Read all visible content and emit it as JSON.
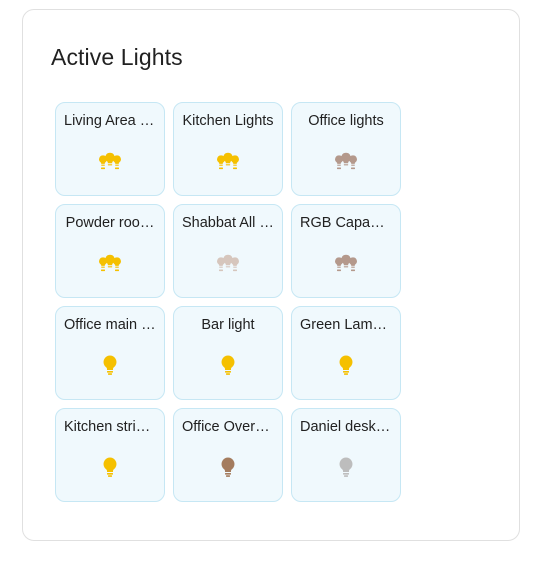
{
  "card": {
    "title": "Active Lights"
  },
  "lights": [
    {
      "name": "Living Area L…",
      "icon": "bulb-group-icon",
      "color": "#f5c000"
    },
    {
      "name": "Kitchen Lights",
      "icon": "bulb-group-icon",
      "color": "#f5c000"
    },
    {
      "name": "Office lights",
      "icon": "bulb-group-icon",
      "color": "#b4998c"
    },
    {
      "name": "Powder roo…",
      "icon": "bulb-group-icon",
      "color": "#f5c000"
    },
    {
      "name": "Shabbat All l…",
      "icon": "bulb-group-icon",
      "color": "#d6c6bd"
    },
    {
      "name": "RGB Capable…",
      "icon": "bulb-group-icon",
      "color": "#b4998c"
    },
    {
      "name": "Office main (…",
      "icon": "bulb-icon",
      "color": "#f5c000"
    },
    {
      "name": "Bar light",
      "icon": "bulb-icon",
      "color": "#f5c000"
    },
    {
      "name": "Green Lamp …",
      "icon": "bulb-icon",
      "color": "#f5c000"
    },
    {
      "name": "Kitchen strip …",
      "icon": "bulb-icon",
      "color": "#f5c000"
    },
    {
      "name": "Office Overh…",
      "icon": "bulb-icon",
      "color": "#a47c5e"
    },
    {
      "name": "Daniel desk li…",
      "icon": "bulb-icon",
      "color": "#bdbdbd"
    }
  ]
}
